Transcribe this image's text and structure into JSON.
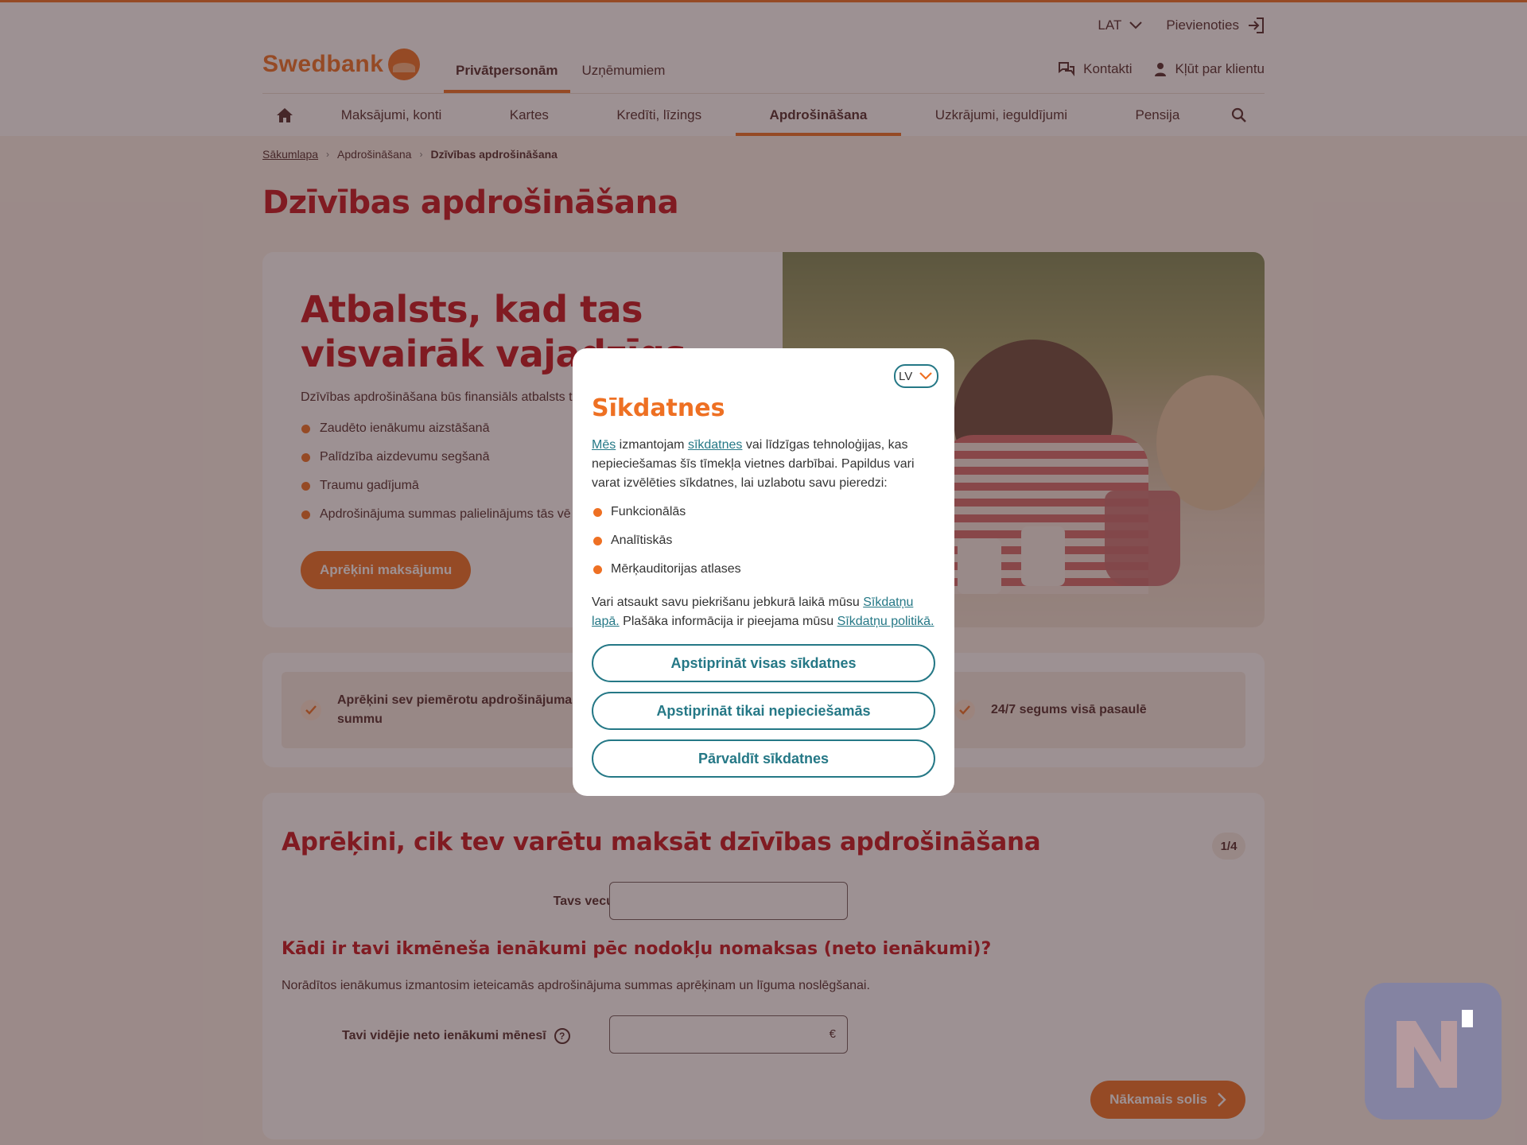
{
  "header": {
    "language": "LAT",
    "login": "Pievienoties",
    "logo": "Swedbank",
    "segments": [
      "Privātpersonām",
      "Uzņēmumiem"
    ],
    "contacts": "Kontakti",
    "become_client": "Kļūt par klientu",
    "nav": [
      "Maksājumi, konti",
      "Kartes",
      "Kredīti, līzings",
      "Apdrošināšana",
      "Uzkrājumi, ieguldījumi",
      "Pensija"
    ]
  },
  "breadcrumb": [
    "Sākumlapa",
    "Apdrošināšana",
    "Dzīvības apdrošināšana"
  ],
  "page_title": "Dzīvības apdrošināšana",
  "hero": {
    "title_line1": "Atbalsts, kad tas",
    "title_line2": "visvairāk vajadzīgs",
    "lead": "Dzīvības apdrošināšana būs finansiāls atbalsts t",
    "bullets": [
      "Zaudēto ienākumu aizstāšanā",
      "Palīdzība aizdevumu segšanā",
      "Traumu gadījumā",
      "Apdrošinājuma summas palielinājums tās vē"
    ],
    "cta": "Aprēķini maksājumu"
  },
  "features": [
    "Aprēķini sev piemērotu apdrošinājuma summu",
    "24/7 segums visā pasaulē"
  ],
  "calculator": {
    "title": "Aprēķini, cik tev varētu maksāt dzīvības apdrošināšana",
    "step": "1/4",
    "age_label": "Tavs vecums",
    "income_title": "Kādi ir tavi ikmēneša ienākumi pēc nodokļu nomaksas (neto ienākumi)?",
    "income_note": "Norādītos ienākumus izmantosim ieteicamās apdrošinājuma summas aprēķinam un līguma noslēgšanai.",
    "income_label": "Tavi vidējie neto ienākumi mēnesī",
    "help": "?",
    "currency": "€",
    "next": "Nākamais solis"
  },
  "cookie_modal": {
    "language": "LV",
    "title": "Sīkdatnes",
    "intro_link1": "Mēs",
    "intro_text1": " izmantojam ",
    "intro_link2": "sīkdatnes",
    "intro_text2": " vai līdzīgas tehnoloģijas, kas nepieciešamas šīs tīmekļa vietnes darbībai. Papildus vari varat izvēlēties sīkdatnes, lai uzlabotu savu pieredzi:",
    "categories": [
      "Funkcionālās",
      "Analītiskās",
      "Mērķauditorijas atlases"
    ],
    "outro_text1": "Vari atsaukt savu piekrišanu jebkurā laikā mūsu ",
    "outro_link1": "Sīkdatņu lapā.",
    "outro_text2": " Plašāka informācija ir pieejama mūsu ",
    "outro_link2": "Sīkdatņu politikā.",
    "accept_all": "Apstiprināt visas sīkdatnes",
    "accept_necessary": "Apstiprināt tikai nepieciešamās",
    "manage": "Pārvaldīt sīkdatnes"
  },
  "colors": {
    "brand_orange": "#ee7023",
    "heading_red": "#c5131c",
    "link_teal": "#257886"
  }
}
